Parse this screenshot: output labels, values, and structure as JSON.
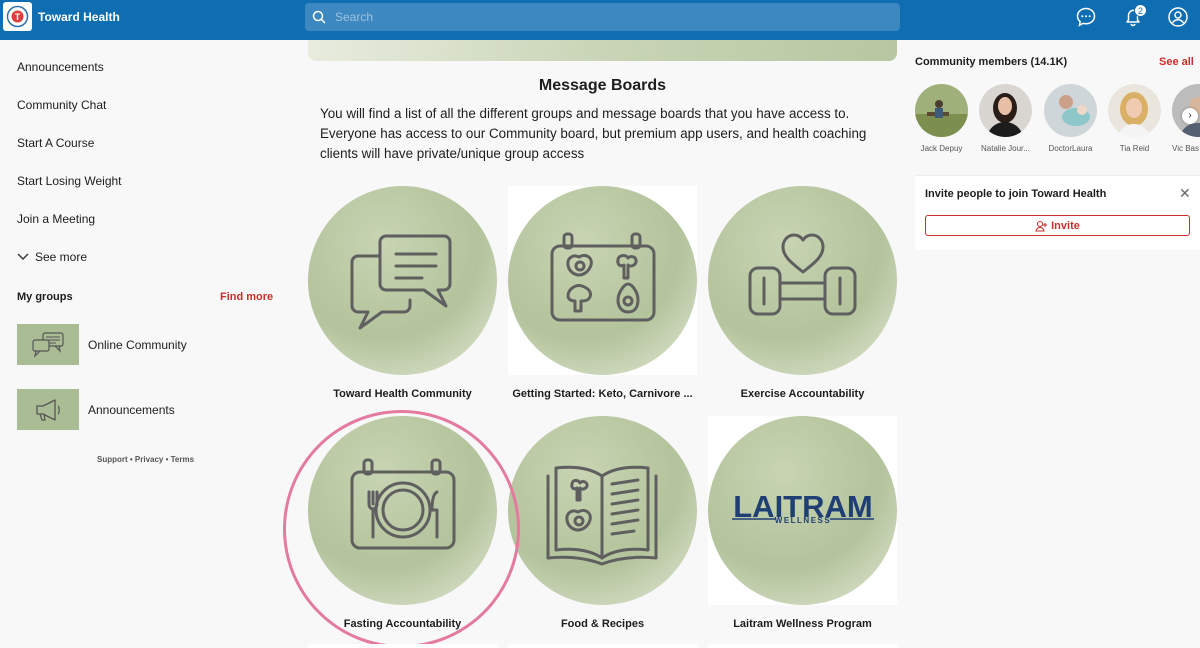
{
  "header": {
    "app_title": "Toward Health",
    "search_placeholder": "Search",
    "notification_count": "2",
    "colors": {
      "brand": "#0f6db2",
      "accent": "#c9302c"
    }
  },
  "sidebar": {
    "nav_items": [
      "Announcements",
      "Community Chat",
      "Start A Course",
      "Start Losing Weight",
      "Join a Meeting"
    ],
    "see_more": "See more",
    "my_groups_title": "My groups",
    "find_more": "Find more",
    "groups": [
      {
        "name": "Online Community",
        "icon": "chat-bubbles-icon"
      },
      {
        "name": "Announcements",
        "icon": "megaphone-icon"
      }
    ],
    "footer": "Support • Privacy • Terms"
  },
  "main": {
    "title": "Message Boards",
    "intro": "You will find a list of all the different groups and message boards that you have access to. Everyone has access to our Community board, but premium app users, and health coaching clients will have private/unique group access",
    "boards": [
      {
        "label": "Toward Health Community",
        "icon": "chat-bubbles-icon"
      },
      {
        "label": "Getting Started: Keto, Carnivore ...",
        "icon": "meal-tray-icon"
      },
      {
        "label": "Exercise Accountability",
        "icon": "dumbbell-heart-icon"
      },
      {
        "label": "Fasting Accountability",
        "icon": "plate-cutlery-icon"
      },
      {
        "label": "Food & Recipes",
        "icon": "recipe-book-icon"
      },
      {
        "label": "Laitram Wellness Program",
        "icon": "laitram-logo",
        "logo_text": "LAITRAM",
        "logo_subtext": "WELLNESS"
      }
    ]
  },
  "right": {
    "members_title": "Community members (14.1K)",
    "see_all": "See all",
    "members": [
      "Jack Depuy",
      "Natalie Jour...",
      "DoctorLaura",
      "Tia Reid",
      "Vic Bas"
    ],
    "invite_title": "Invite people to join Toward Health",
    "invite_button": "Invite"
  }
}
